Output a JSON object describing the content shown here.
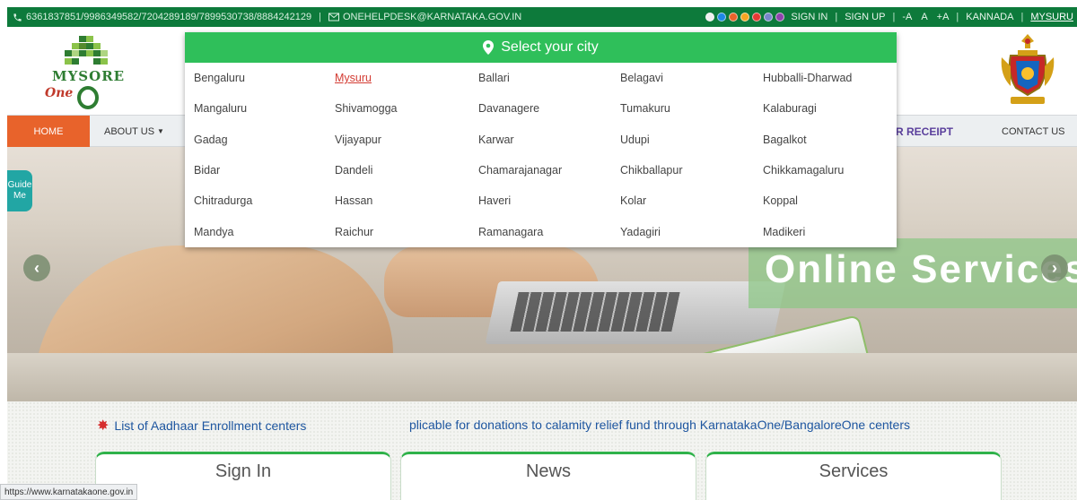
{
  "topbar": {
    "phones": "6361837851/9986349582/7204289189/7899530738/8884242129",
    "separator": "|",
    "email": "ONEHELPDESK@KARNATAKA.GOV.IN",
    "theme_colors": [
      "#f0f0f0",
      "#1e88e5",
      "#e8632b",
      "#f6a623",
      "#e53935",
      "#7986cb",
      "#8e44ad"
    ],
    "sign_in": "SIGN IN",
    "sign_up": "SIGN UP",
    "font_decrease": "-A",
    "font_normal": "A",
    "font_increase": "+A",
    "language": "KANNADA",
    "city": "MYSURU"
  },
  "header": {
    "logo_text": "MYSORE",
    "logo_sub": "One"
  },
  "nav": {
    "home": "HOME",
    "about": "ABOUT US",
    "receipt": "R RECEIPT",
    "contact": "CONTACT US"
  },
  "guide": {
    "line1": "Guide",
    "line2": "Me"
  },
  "hero": {
    "banner": "Online Services"
  },
  "ticker": {
    "item1": "List of Aadhaar Enrollment centers",
    "item2": "plicable for donations to calamity relief fund through KarnatakaOne/BangaloreOne centers"
  },
  "cards": {
    "signin": "Sign In",
    "news": "News",
    "services": "Services"
  },
  "city_dropdown": {
    "title": "Select your city",
    "selected": "Mysuru",
    "cities": [
      "Bengaluru",
      "Mysuru",
      "Ballari",
      "Belagavi",
      "Hubballi-Dharwad",
      "Mangaluru",
      "Shivamogga",
      "Davanagere",
      "Tumakuru",
      "Kalaburagi",
      "Gadag",
      "Vijayapur",
      "Karwar",
      "Udupi",
      "Bagalkot",
      "Bidar",
      "Dandeli",
      "Chamarajanagar",
      "Chikballapur",
      "Chikkamagaluru",
      "Chitradurga",
      "Hassan",
      "Haveri",
      "Kolar",
      "Koppal",
      "Mandya",
      "Raichur",
      "Ramanagara",
      "Yadagiri",
      "Madikeri"
    ]
  },
  "status_bar": {
    "url": "https://www.karnatakaone.gov.in"
  }
}
